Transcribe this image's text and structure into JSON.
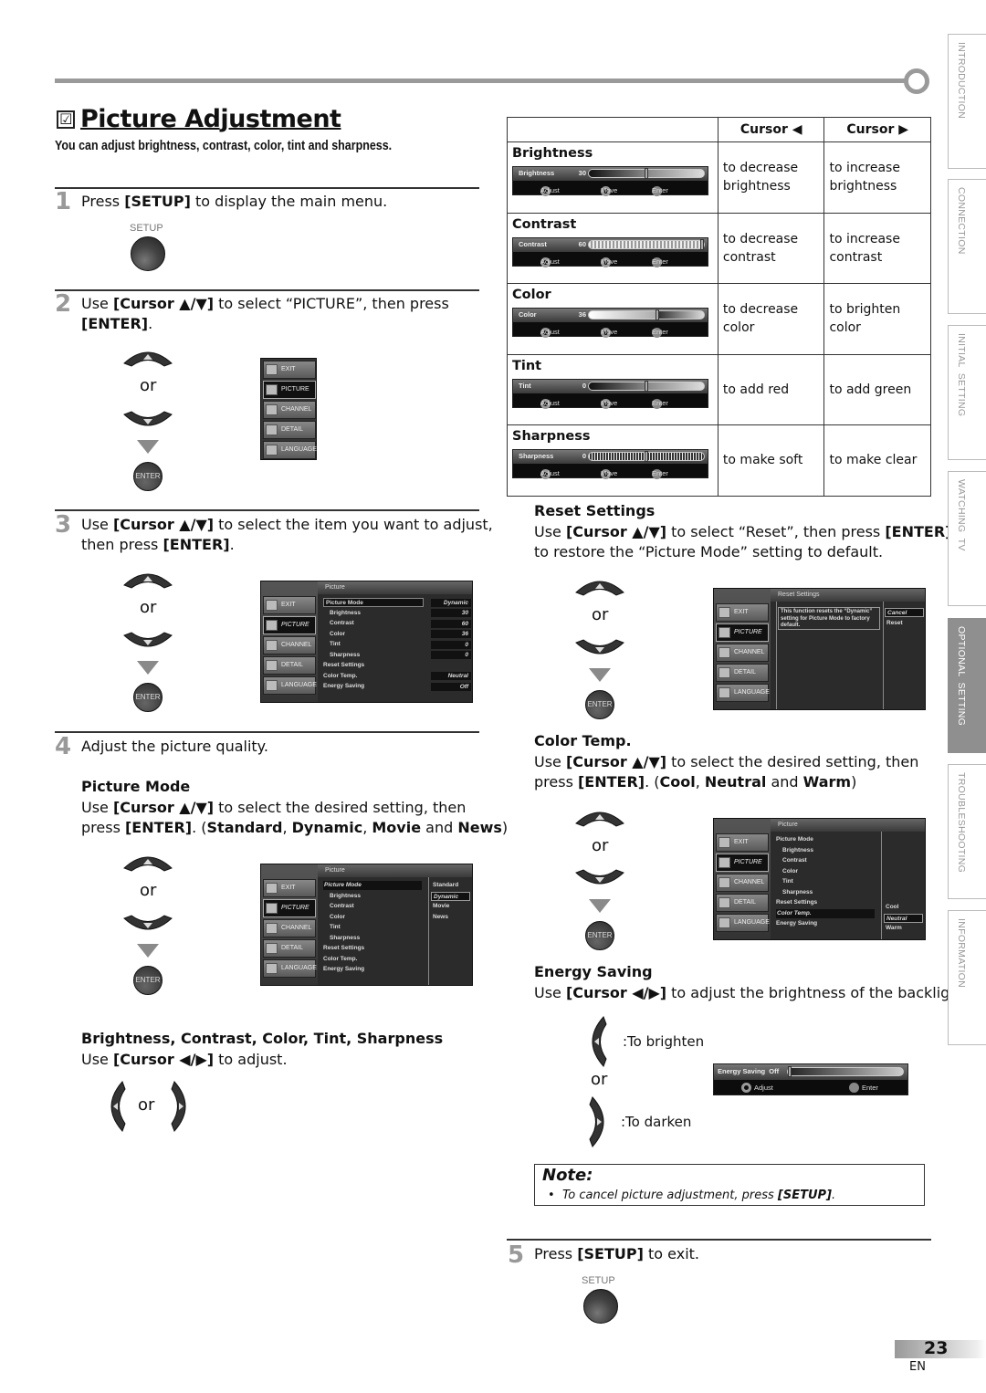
{
  "header": {
    "checkbox_glyph": "☑",
    "title": "Picture Adjustment",
    "subtitle": "You can adjust brightness, contrast, color, tint and sharpness."
  },
  "steps": [
    {
      "number": "1",
      "pre": "Press ",
      "key": "[SETUP]",
      "post": " to display the main menu.",
      "button_label": "SETUP"
    },
    {
      "number": "2",
      "pre": "Use ",
      "key": "[Cursor ▲/▼]",
      "post": " to select “PICTURE”, then press",
      "line2": "[ENTER]",
      "line2_post": "."
    },
    {
      "number": "3",
      "pre": "Use ",
      "key": "[Cursor ▲/▼]",
      "post": " to select the item you want to adjust,",
      "line2_pre": "then press ",
      "line2": "[ENTER]",
      "line2_post": "."
    },
    {
      "number": "4",
      "text": "Adjust the picture quality."
    },
    {
      "number": "5",
      "pre": "Press ",
      "key": "[SETUP]",
      "post": " to exit.",
      "button_label": "SETUP"
    }
  ],
  "remote": {
    "or": "or",
    "enter_label": "ENTER"
  },
  "main_menu": {
    "items": [
      "EXIT",
      "PICTURE",
      "CHANNEL",
      "DETAIL",
      "LANGUAGE"
    ],
    "selected": "PICTURE"
  },
  "picture_menu": {
    "header": "Picture",
    "rows": [
      {
        "label": "Picture Mode",
        "value": "Dynamic",
        "indent": false
      },
      {
        "label": "Brightness",
        "value": "30",
        "indent": true
      },
      {
        "label": "Contrast",
        "value": "60",
        "indent": true
      },
      {
        "label": "Color",
        "value": "36",
        "indent": true
      },
      {
        "label": "Tint",
        "value": "0",
        "indent": true
      },
      {
        "label": "Sharpness",
        "value": "0",
        "indent": true
      },
      {
        "label": "Reset Settings",
        "value": "",
        "indent": false
      },
      {
        "label": "Color Temp.",
        "value": "Neutral",
        "indent": false
      },
      {
        "label": "Energy Saving",
        "value": "Off",
        "indent": false
      }
    ]
  },
  "picture_mode": {
    "heading": "Picture Mode",
    "pre": "Use ",
    "key": "[Cursor ▲/▼]",
    "post": " to select the desired setting, then",
    "line2": "press [ENTER]. (Standard, Dynamic, Movie and News)",
    "line2_parts": [
      {
        "t": "press ",
        "b": false
      },
      {
        "t": "[ENTER]",
        "b": true
      },
      {
        "t": ". (",
        "b": false
      },
      {
        "t": "Standard",
        "b": true
      },
      {
        "t": ", ",
        "b": false
      },
      {
        "t": "Dynamic",
        "b": true
      },
      {
        "t": ", ",
        "b": false
      },
      {
        "t": "Movie",
        "b": true
      },
      {
        "t": " and ",
        "b": false
      },
      {
        "t": "News",
        "b": true
      },
      {
        "t": ")",
        "b": false
      }
    ],
    "options": [
      "Standard",
      "Dynamic",
      "Movie",
      "News"
    ],
    "selected": "Dynamic"
  },
  "bcct": {
    "heading": "Brightness, Contrast, Color, Tint, Sharpness",
    "pre": "Use ",
    "key": "[Cursor ◀/▶]",
    "post": " to adjust."
  },
  "table": {
    "col_left": "Cursor ◀",
    "col_right": "Cursor ▶",
    "rows": [
      {
        "item": "Brightness",
        "slider_label": "Brightness",
        "value": "30",
        "level": 0.5,
        "left": "to decrease brightness",
        "right": "to increase brightness"
      },
      {
        "item": "Contrast",
        "slider_label": "Contrast",
        "value": "60",
        "level": 1.0,
        "left": "to decrease contrast",
        "right": "to increase contrast"
      },
      {
        "item": "Color",
        "slider_label": "Color",
        "value": "36",
        "level": 0.6,
        "left": "to decrease color",
        "right": "to brighten color"
      },
      {
        "item": "Tint",
        "slider_label": "Tint",
        "value": "0",
        "level": 0.5,
        "left": "to add red",
        "right": "to add green"
      },
      {
        "item": "Sharpness",
        "slider_label": "Sharpness",
        "value": "0",
        "level": 0.5,
        "left": "to make soft",
        "right": "to make clear"
      }
    ],
    "hint_adjust": "Adjust",
    "hint_move": "Move",
    "hint_enter": "Enter"
  },
  "reset": {
    "heading": "Reset Settings",
    "pre": "Use ",
    "key": "[Cursor ▲/▼]",
    "post": " to select “Reset”, then press ",
    "key2": "[ENTER]",
    "line2": "to restore the “Picture Mode” setting to default.",
    "menu_header": "Reset Settings",
    "message": "This function resets the “Dynamic” setting for Picture Mode to factory default.",
    "options": [
      "Cancel",
      "Reset"
    ],
    "selected": "Cancel"
  },
  "color_temp": {
    "heading": "Color Temp.",
    "pre": "Use ",
    "key": "[Cursor ▲/▼]",
    "post": " to select the desired setting, then",
    "line2_parts": [
      {
        "t": "press ",
        "b": false
      },
      {
        "t": "[ENTER]",
        "b": true
      },
      {
        "t": ". (",
        "b": false
      },
      {
        "t": "Cool",
        "b": true
      },
      {
        "t": ", ",
        "b": false
      },
      {
        "t": "Neutral",
        "b": true
      },
      {
        "t": " and ",
        "b": false
      },
      {
        "t": "Warm",
        "b": true
      },
      {
        "t": ")",
        "b": false
      }
    ],
    "options": [
      "Cool",
      "Neutral",
      "Warm"
    ],
    "selected": "Neutral"
  },
  "energy": {
    "heading": "Energy Saving",
    "pre": "Use ",
    "key": "[Cursor ◀/▶]",
    "post": " to adjust the brightness of the backlight.",
    "brighten": ":To brighten",
    "darken": ":To darken",
    "slider_label": "Energy Saving",
    "value": "Off",
    "level": 0.0,
    "hint_adjust": "Adjust",
    "hint_enter": "Enter"
  },
  "note": {
    "title": "Note:",
    "bullet": "•",
    "text": "To cancel picture adjustment, press ",
    "key": "[SETUP]",
    "end": "."
  },
  "side_tabs": [
    {
      "label": "INTRODUCTION",
      "active": false
    },
    {
      "label": "CONNECTION",
      "active": false
    },
    {
      "label": "INITIAL  SETTING",
      "active": false
    },
    {
      "label": "WATCHING  TV",
      "active": false
    },
    {
      "label": "OPTIONAL  SETTING",
      "active": true
    },
    {
      "label": "TROUBLESHOOTING",
      "active": false
    },
    {
      "label": "INFORMATION",
      "active": false
    }
  ],
  "footer": {
    "page": "23",
    "lang": "EN"
  },
  "colors": {
    "accent_gray": "#9a9a9a",
    "active_tab": "#8f8f8f",
    "tv_bg": "#2b2b2b"
  }
}
